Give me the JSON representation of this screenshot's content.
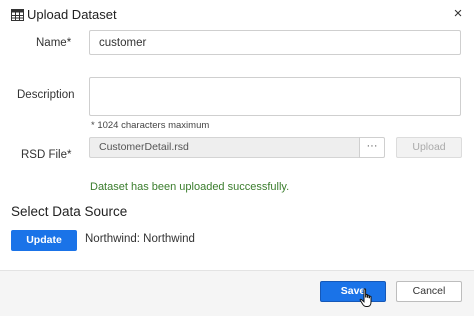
{
  "dialog": {
    "title": "Upload Dataset",
    "close_symbol": "×",
    "title_icon": "table-icon"
  },
  "form": {
    "name_label": "Name",
    "required_mark": "*",
    "name_value": "customer",
    "description_label": "Description",
    "description_value": "",
    "description_hint": "* 1024 characters maximum",
    "rsd_label": "RSD File",
    "rsd_file_value": "CustomerDetail.rsd",
    "browse_label": "···",
    "upload_label": "Upload",
    "success_message": "Dataset has been uploaded successfully."
  },
  "data_source": {
    "section_title": "Select Data Source",
    "update_label": "Update",
    "source_value": "Northwind: Northwind"
  },
  "footer": {
    "save_label": "Save",
    "cancel_label": "Cancel"
  },
  "colors": {
    "primary": "#1a73e8",
    "success": "#3a7d2c",
    "footer_bg": "#f5f5f5"
  }
}
